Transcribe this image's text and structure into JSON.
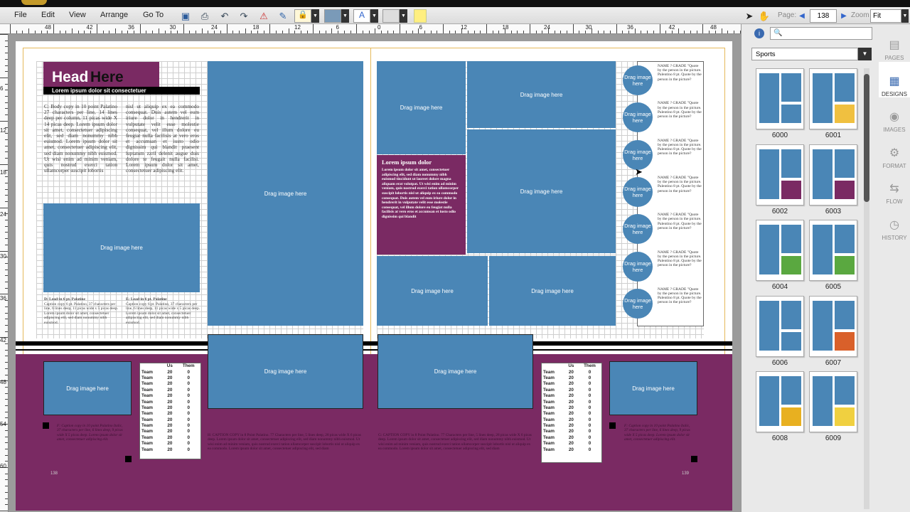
{
  "menu": [
    "File",
    "Edit",
    "View",
    "Arrange",
    "Go To"
  ],
  "toolbar": {
    "page_label": "Page:",
    "page_value": "138",
    "zoom_label": "Zoom",
    "zoom_value": "Fit"
  },
  "ruler": {
    "h": [
      "48",
      "42",
      "36",
      "30",
      "24",
      "18",
      "12",
      "6",
      "0",
      "6",
      "12",
      "18",
      "24",
      "30",
      "36",
      "42",
      "48"
    ],
    "v": [
      "6",
      "12",
      "18",
      "24",
      "30",
      "36",
      "42",
      "48",
      "54",
      "60"
    ]
  },
  "spread": {
    "headline_a": "Head",
    "headline_b": "Here",
    "subhead": "Lorem ipsum dolor sit consectetuer",
    "body_left": "C: Body copy in 10 point Palatino 27 characters per line, 14 lines deep per column, 11 picas wide X 14 picas deep. Lorem ipsum dolor sit amet, consectetuer adipiscing elit, sed diam nonummy nibh euismod. Lorem ipsum dolor sit amet, consectetuer adipiscing elit, sed diam nonummy nibh euismod. Ut wisi enim ad minim veniam, quis nostrud exerci tation ullamcorper suscipit lobortis",
    "body_right": "nisl ut aliquip ex ea commodo consequat. Duis autem vel eum iriure dolor in hendrerit in vulputate velit esse molestie consequat, vel illum dolore eu feugiat nulla facilisis at vero eros et accumsan et iusto odio dignissim qui blandit praesent luptatum zzril delenit augue duis dolore te feugait nulla facilisi. Lorem ipsum dolor sit amet, consectetuer adipiscing elit.",
    "cap_d": "D: Lead-in 6 pt. Palatine",
    "cap_d_body": "Caption copy 6 pt. Palatino, 37 characters per line, 6 lines deep, 11 picas wide x 5 picas deep. Lorem ipsum dolor sit amet, consectetuer adipiscing elit, sed diam nonummy nibh euismod.",
    "cap_e": "E: Lead-in 6 pt. Palatine",
    "cap_e_body": "Caption copy 6 pt. Palatino, 37 characters per line, 6 lines deep, 11 picas wide x 5 picas deep. Lorem ipsum dolor sit amet, consectetuer adipiscing elit, sed diam nonummy nibh euismod.",
    "drag": "Drag image here",
    "lorem_title": "Lorem ipsum dolor",
    "lorem_body": "Lorem ipsum dolor sit amet, consectetuer adipiscing elit, sed diam nonummy nibh euismod tincidunt ut laoreet dolore magna aliquam erat volutpat. Ut wisi enim ad minim veniam, quis nostrud exerci tation ullamcorper suscipit lobortis nisl ut aliquip ex ea commodo consequat. Duis autem vel eum iriure dolor in hendrerit in vulputate velit esse molestie consequat, vel illum dolore eu feugiat nulla facilisis at vero eros et accumsan et iusto odio dignissim qui blandit",
    "quote": "NAME ? GRADE \"Quote by the person in the picture. Palentino 8 pt. Quote by the person in the picture?",
    "purple_cap_left": "F: Caption copy in 10 point Palatino Italic, 37 characters per line, 6 lines deep, 9 picas wide X 5 picas deep. Lorem ipsum dolor sit amet, consectetuer adipiscing elit.",
    "purple_cap_mid": "H: CAPTION COPY in 8 Point Palatino. 77 Characters per line, 5 lines deep, 28 picas wide X 6 picas deep. Lorem ipsum dolor sit amet, consectetuer adipiscing elit, sed diam nonummy nibh euismod. Ut wisi enim ad minim veniam, quis nostrud exerci tation ullamcorper suscipit lobortis nisl ut aliquip ex ea commodo. Lorem ipsum dolor sit amet, consectetuer adipiscing elit, sed diam",
    "purple_cap_mid2": "G: CAPTION COPY in 8 Point Palatino. 77 Characters per line, 5 lines deep, 28 picas wide X 6 picas deep. Lorem ipsum dolor sit amet, consectetuer adipiscing elit, sed diam nonummy nibh euismod. Ut wisi enim ad minim veniam, quis nostrud exerci tation ullamcorper suscipit lobortis nisl ut aliquip ex ea commodo. Lorem ipsum dolor sit amet, consectetuer adipiscing elit, sed diam",
    "purple_cap_right": "F: Caption copy in 10 point Palatino Italic, 37 characters per line, 6 lines deep, 9 picas wide X 5 picas deep. Lorem ipsum dolor sit amet, consectetuer adipiscing elit.",
    "page_left": "138",
    "page_right": "139",
    "score_head": [
      "",
      "Us",
      "Them"
    ],
    "score_row": [
      "Team",
      "20",
      "0"
    ]
  },
  "panel": {
    "category": "Sports",
    "thumbs": [
      "6000",
      "6001",
      "6002",
      "6003",
      "6004",
      "6005",
      "6006",
      "6007",
      "6008",
      "6009"
    ],
    "tabs": [
      "PAGES",
      "DESIGNS",
      "IMAGES",
      "FORMAT",
      "FLOW",
      "HISTORY"
    ]
  }
}
